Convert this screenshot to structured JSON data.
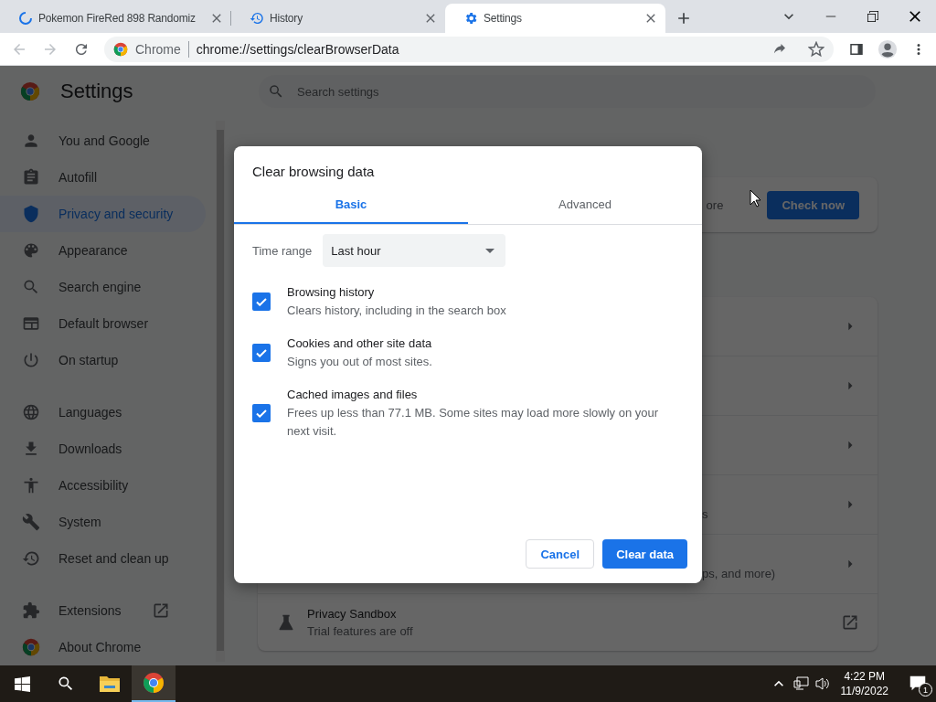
{
  "browser": {
    "tabs": [
      {
        "title": "Pokemon FireRed 898 Randomiz",
        "selected": false
      },
      {
        "title": "History",
        "selected": false
      },
      {
        "title": "Settings",
        "selected": true
      }
    ],
    "omnibox": {
      "site_label": "Chrome",
      "url": "chrome://settings/clearBrowserData"
    }
  },
  "settings": {
    "title": "Settings",
    "search": {
      "placeholder": "Search settings"
    },
    "sidebar": [
      {
        "items": [
          {
            "label": "You and Google",
            "selected": false,
            "kind": "page"
          },
          {
            "label": "Autofill",
            "selected": false,
            "kind": "page"
          },
          {
            "label": "Privacy and security",
            "selected": true,
            "kind": "page"
          },
          {
            "label": "Appearance",
            "selected": false,
            "kind": "page"
          },
          {
            "label": "Search engine",
            "selected": false,
            "kind": "page"
          },
          {
            "label": "Default browser",
            "selected": false,
            "kind": "page"
          },
          {
            "label": "On startup",
            "selected": false,
            "kind": "page"
          }
        ]
      },
      {
        "items": [
          {
            "label": "Languages",
            "selected": false,
            "kind": "page"
          },
          {
            "label": "Downloads",
            "selected": false,
            "kind": "page"
          },
          {
            "label": "Accessibility",
            "selected": false,
            "kind": "page"
          },
          {
            "label": "System",
            "selected": false,
            "kind": "page"
          },
          {
            "label": "Reset and clean up",
            "selected": false,
            "kind": "page"
          }
        ]
      },
      {
        "items": [
          {
            "label": "Extensions",
            "selected": false,
            "kind": "external"
          },
          {
            "label": "About Chrome",
            "selected": false,
            "kind": "page"
          }
        ]
      }
    ],
    "safety_check": {
      "partial_text": "ore",
      "button": "Check now"
    },
    "rows": [
      {
        "kind": "subpage"
      },
      {
        "kind": "subpage"
      },
      {
        "kind": "subpage"
      },
      {
        "kind": "subpage",
        "text": "s"
      },
      {
        "kind": "subpage",
        "text": "ps, and more)"
      },
      {
        "kind": "external",
        "title": "Privacy Sandbox",
        "subtitle": "Trial features are off"
      }
    ]
  },
  "dialog": {
    "title": "Clear browsing data",
    "tabs": [
      {
        "label": "Basic",
        "selected": true
      },
      {
        "label": "Advanced",
        "selected": false
      }
    ],
    "time_range": {
      "label": "Time range",
      "value": "Last hour"
    },
    "options": [
      {
        "title": "Browsing history",
        "description": "Clears history, including in the search box",
        "checked": true
      },
      {
        "title": "Cookies and other site data",
        "description": "Signs you out of most sites.",
        "checked": true
      },
      {
        "title": "Cached images and files",
        "description": "Frees up less than 77.1 MB. Some sites may load more slowly on your next visit.",
        "checked": true
      }
    ],
    "buttons": {
      "cancel": "Cancel",
      "confirm": "Clear data"
    }
  },
  "taskbar": {
    "time": "4:22 PM",
    "date": "11/9/2022",
    "notification_count": "1"
  }
}
